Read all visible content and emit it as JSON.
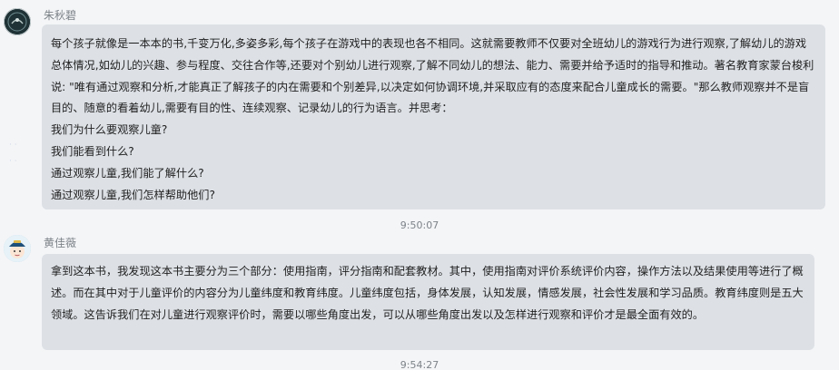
{
  "messages": [
    {
      "sender": "朱秋碧",
      "avatar_icon": "profile-avatar-dark",
      "paragraphs": [
        "每个孩子就像是一本本的书,千变万化,多姿多彩,每个孩子在游戏中的表现也各不相同。这就需要教师不仅要对全班幼儿的游戏行为进行观察,了解幼儿的游戏总体情况,如幼儿的兴趣、参与程度、交往合作等,还要对个别幼儿进行观察,了解不同幼儿的想法、能力、需要并给予适时的指导和推动。著名教育家蒙台梭利说: \"唯有通过观察和分析,才能真正了解孩子的内在需要和个别差异,以决定如何协调环境,并采取应有的态度来配合儿童成长的需要。\"那么教师观察并不是盲目的、随意的看着幼儿,需要有目的性、连续观察、记录幼儿的行为语言。并思考：",
        "我们为什么要观察儿童?",
        "我们能看到什么?",
        "通过观察儿童,我们能了解什么?",
        "通过观察儿童,我们怎样帮助他们?"
      ],
      "time": "9:50:07"
    },
    {
      "sender": "黄佳薇",
      "avatar_icon": "profile-avatar-cartoon",
      "paragraphs": [
        "拿到这本书，我发现这本书主要分为三个部分：使用指南，评分指南和配套教材。其中，使用指南对评价系统评价内容，操作方法以及结果使用等进行了概述。而在其中对于儿童评价的内容分为儿童纬度和教育纬度。儿童纬度包括，身体发展，认知发展，情感发展，社会性发展和学习品质。教育纬度则是五大领域。这告诉我们在对儿童进行观察评价时，需要以哪些角度出发，可以从哪些角度出发以及怎样进行观察和评价才是最全面有效的。"
      ],
      "time": "9:54:27"
    }
  ],
  "colors": {
    "background": "#f4f5f7",
    "bubble": "#dde1e6",
    "sender_text": "#7c8389",
    "message_text": "#1f1f1f"
  }
}
